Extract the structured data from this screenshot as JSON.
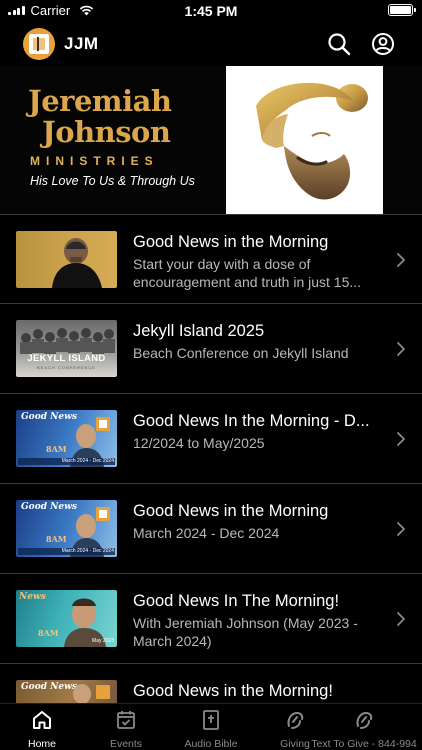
{
  "status": {
    "carrier": "Carrier",
    "time": "1:45 PM"
  },
  "header": {
    "title": "JJM"
  },
  "banner": {
    "name_line1": "Jeremiah",
    "name_line2": "Johnson",
    "ministries": "MINISTRIES",
    "tagline": "His Love To Us & Through Us"
  },
  "list": [
    {
      "title": "Good News in the Morning",
      "subtitle": "Start your day with a dose of encouragement and truth in just 15..."
    },
    {
      "title": "Jekyll Island 2025",
      "subtitle": "Beach Conference on Jekyll Island",
      "thumb_caption": "JEKYLL ISLAND",
      "thumb_sub": "BEACH CONFERENCE"
    },
    {
      "title": "Good News In the Morning - D...",
      "subtitle": "12/2024 to May/2025",
      "thumb_label": "Good News",
      "thumb_date": "March 2024 - Dec 2024",
      "thumb_time": "8AM"
    },
    {
      "title": "Good News in the Morning",
      "subtitle": "March 2024 - Dec 2024",
      "thumb_label": "Good News",
      "thumb_date": "March 2024 - Dec 2024",
      "thumb_time": "8AM"
    },
    {
      "title": "Good News In The Morning!",
      "subtitle": "With Jeremiah Johnson (May 2023 - March 2024)",
      "thumb_label": "News",
      "thumb_date": "May 2023",
      "thumb_time": "8AM"
    },
    {
      "title": "Good News in the Morning!",
      "subtitle": "",
      "thumb_label": "Good News"
    }
  ],
  "tabs": [
    {
      "label": "Home",
      "icon": "home-icon"
    },
    {
      "label": "Events",
      "icon": "calendar-check-icon"
    },
    {
      "label": "Audio Bible",
      "icon": "bible-icon"
    },
    {
      "label": "Giving",
      "icon": "giving-icon"
    },
    {
      "label": "Text To Give - 844-994",
      "icon": "giving-icon"
    }
  ],
  "colors": {
    "gold": "#dba64c",
    "background": "#000000",
    "divider": "#3a3a3a",
    "inactive_tab": "#8a8a8a"
  }
}
